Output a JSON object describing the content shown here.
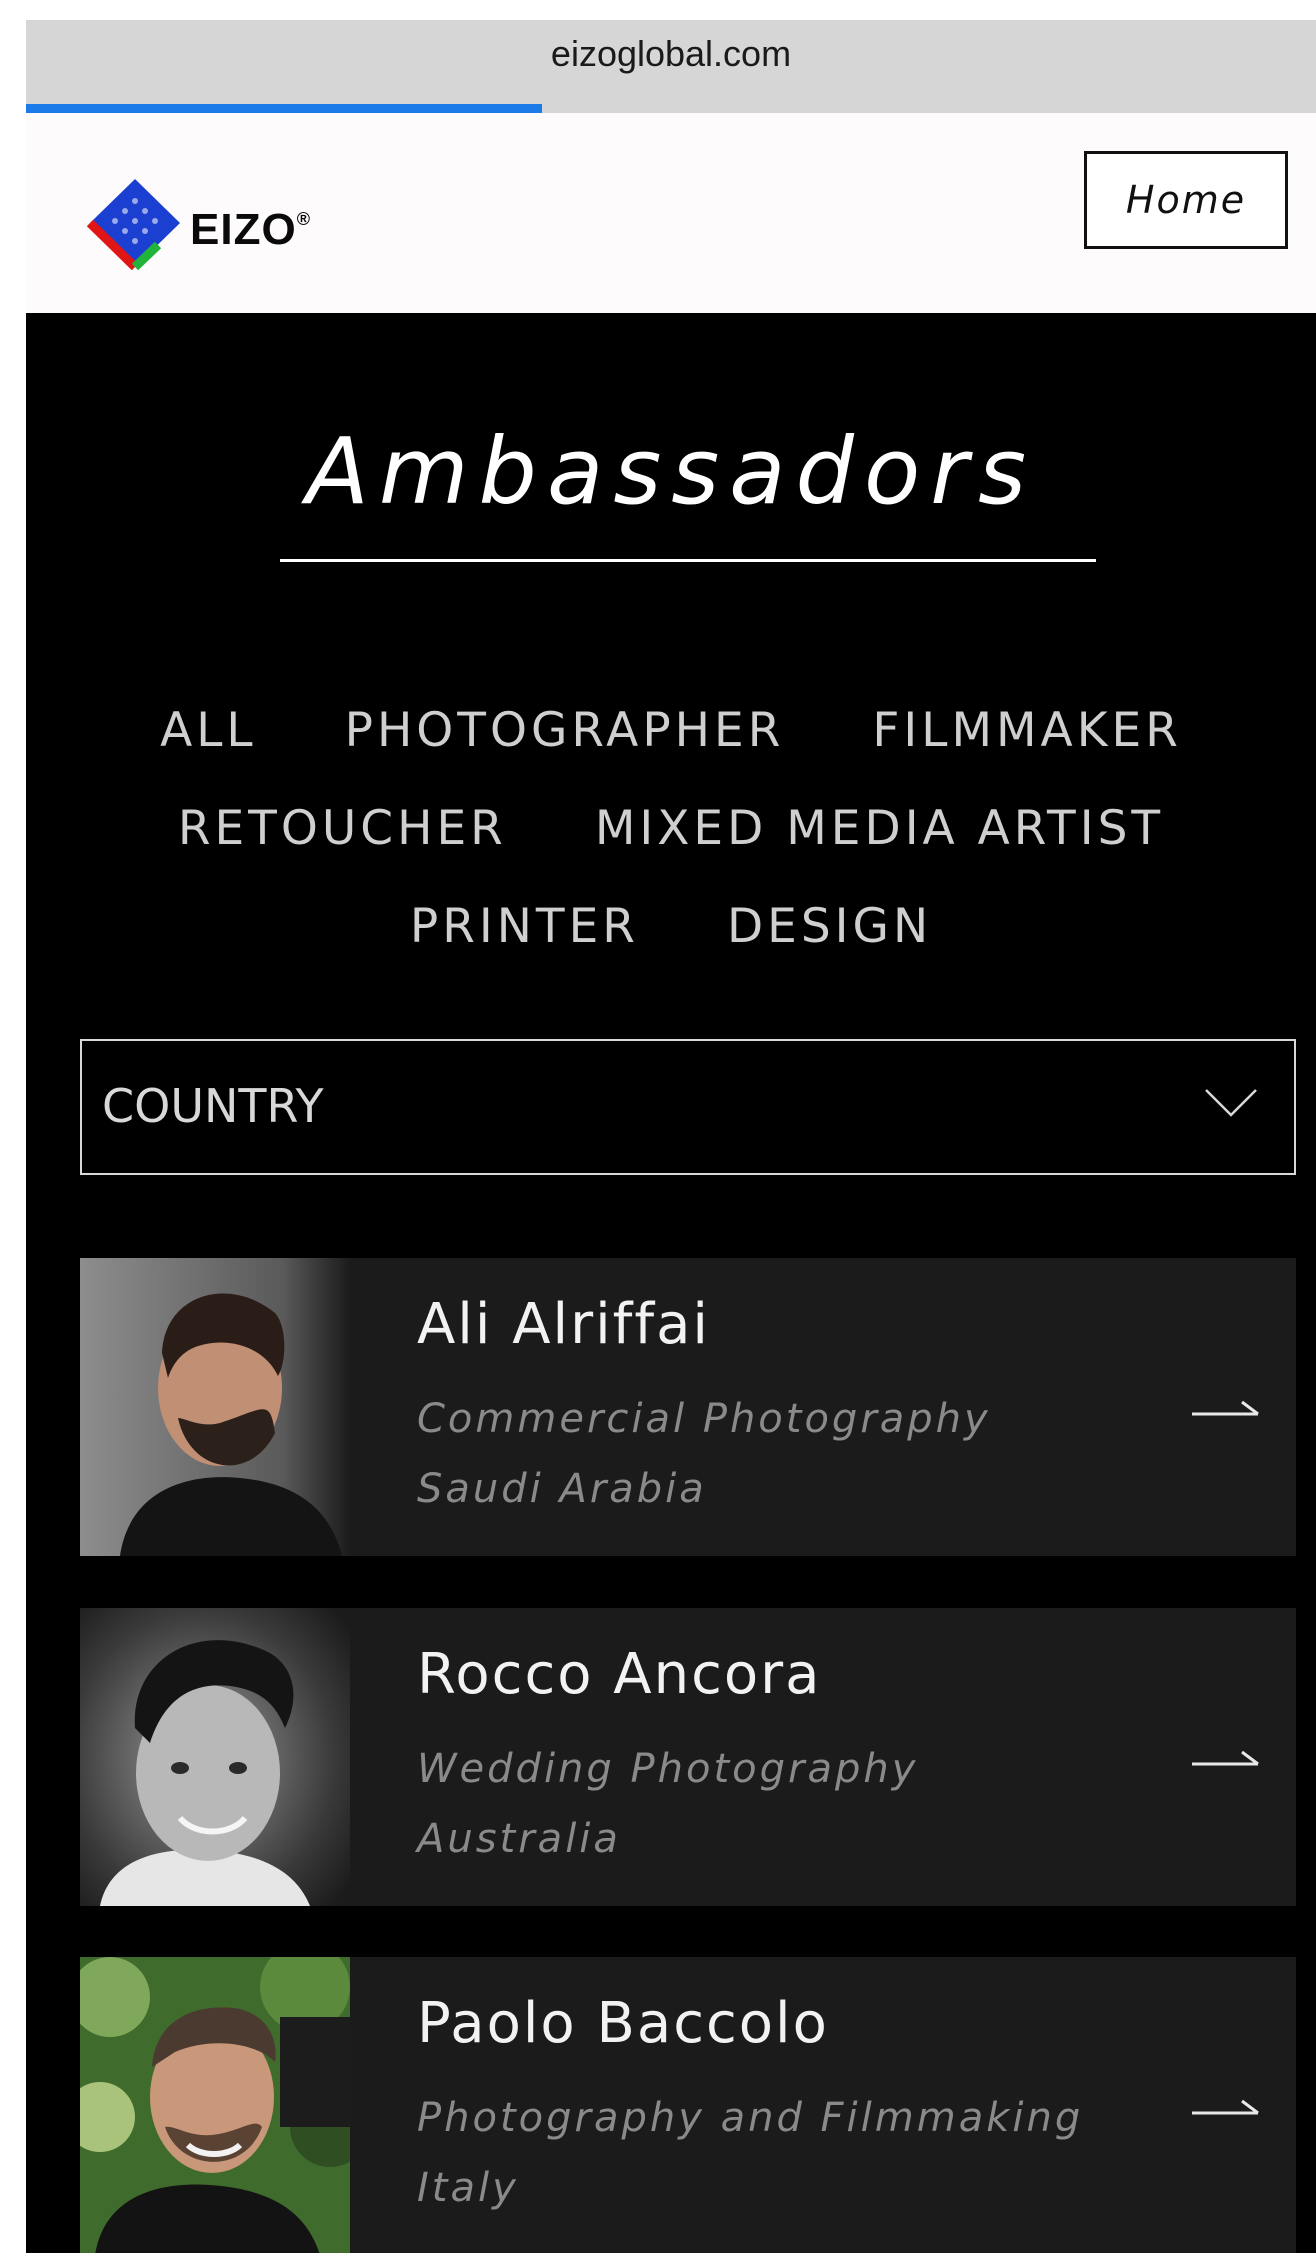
{
  "browser": {
    "url": "eizoglobal.com",
    "load_progress": 0.4
  },
  "header": {
    "logo_text": "EIZO",
    "logo_mark": "®",
    "home_label": "Home"
  },
  "main": {
    "title": "Ambassadors",
    "filters": [
      [
        "ALL",
        "PHOTOGRAPHER",
        "FILMMAKER"
      ],
      [
        "RETOUCHER",
        "MIXED MEDIA ARTIST"
      ],
      [
        "PRINTER",
        "DESIGN"
      ]
    ],
    "country_select": {
      "label": "COUNTRY",
      "icon": "chevron-down-icon"
    },
    "ambassadors": [
      {
        "name": "Ali Alriffai",
        "field": "Commercial Photography",
        "country": "Saudi Arabia",
        "icon": "arrow-right-icon"
      },
      {
        "name": "Rocco Ancora",
        "field": "Wedding Photography",
        "country": "Australia",
        "icon": "arrow-right-icon"
      },
      {
        "name": "Paolo Baccolo",
        "field": "Photography and Filmmaking",
        "country": "Italy",
        "icon": "arrow-right-icon"
      }
    ]
  },
  "colors": {
    "page_bg": "#000000",
    "card_bg": "#1b1b1b",
    "progress": "#1b7be8",
    "header_bg": "#fdfbfb"
  }
}
